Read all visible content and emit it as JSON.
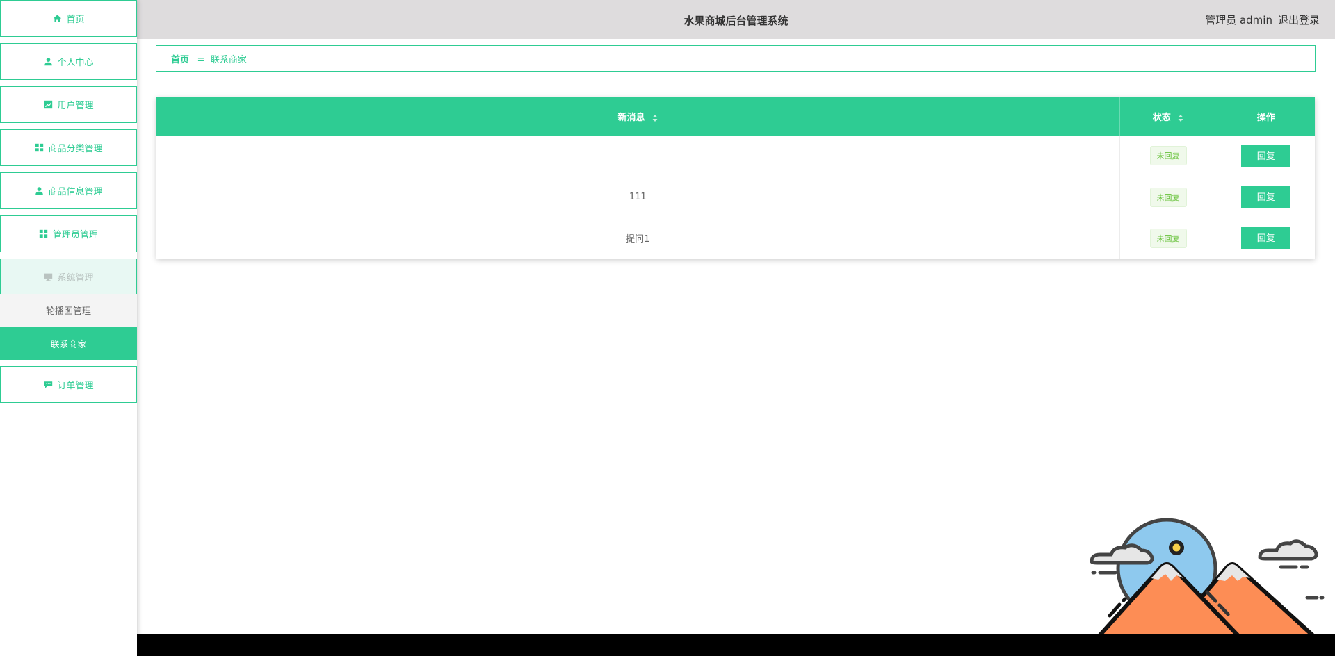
{
  "app": {
    "title": "水果商城后台管理系统",
    "user_label": "管理员 admin",
    "logout_label": "退出登录"
  },
  "sidebar": {
    "items": [
      {
        "label": "首页",
        "icon": "home-icon"
      },
      {
        "label": "个人中心",
        "icon": "user-icon"
      },
      {
        "label": "用户管理",
        "icon": "chart-icon"
      },
      {
        "label": "商品分类管理",
        "icon": "grid-icon"
      },
      {
        "label": "商品信息管理",
        "icon": "user-icon"
      },
      {
        "label": "管理员管理",
        "icon": "grid-icon"
      },
      {
        "label": "系统管理",
        "icon": "monitor-icon"
      },
      {
        "label": "订单管理",
        "icon": "message-icon"
      }
    ],
    "sub_items": [
      {
        "label": "轮播图管理"
      },
      {
        "label": "联系商家"
      }
    ]
  },
  "breadcrumb": {
    "home": "首页",
    "separator": "☰",
    "current": "联系商家"
  },
  "table": {
    "columns": [
      {
        "label": "新消息"
      },
      {
        "label": "状态"
      },
      {
        "label": "操作"
      }
    ],
    "rows": [
      {
        "message": "",
        "status": "未回复",
        "action": "回复"
      },
      {
        "message": "111",
        "status": "未回复",
        "action": "回复"
      },
      {
        "message": "提问1",
        "status": "未回复",
        "action": "回复"
      }
    ]
  },
  "colors": {
    "accent": "#2ecc93",
    "header_bg": "#dedcdd",
    "status_text": "#67c23a",
    "footer": "#000000"
  }
}
